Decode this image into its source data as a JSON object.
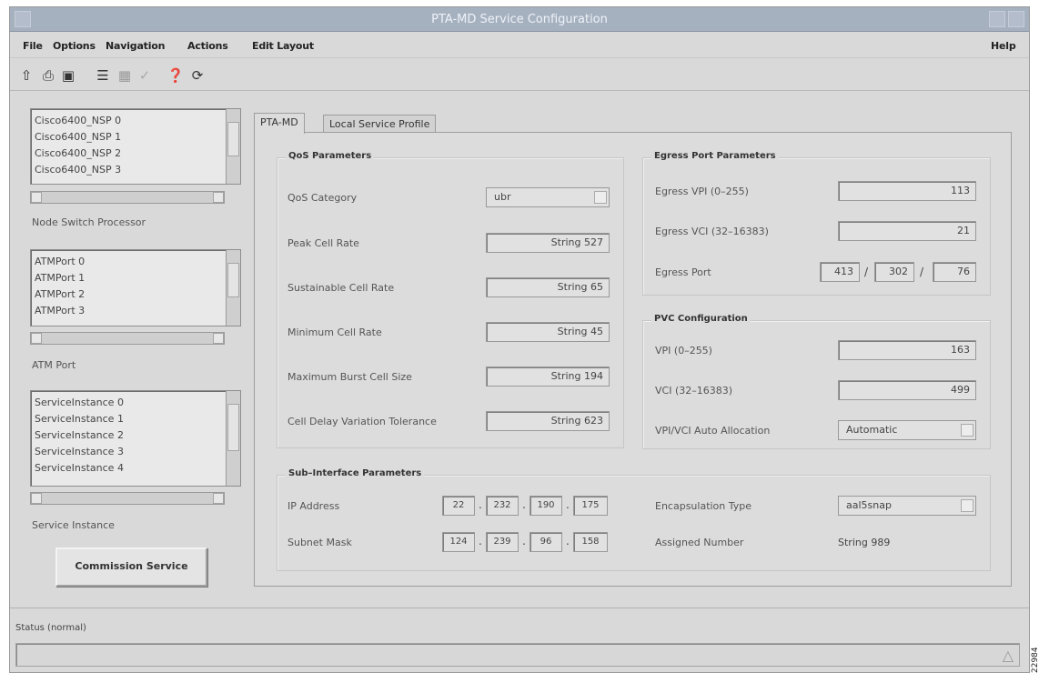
{
  "window": {
    "title": "PTA-MD Service Configuration"
  },
  "menus": [
    "File",
    "Options",
    "Navigation",
    "Actions",
    "Edit Layout"
  ],
  "help": "Help",
  "toolbar": {
    "icons": [
      "pointer-icon",
      "print-icon",
      "print-preview-icon",
      "list-icon",
      "form-icon",
      "checkmark-icon",
      "help-icon",
      "refresh-icon"
    ]
  },
  "lists": {
    "nsp": {
      "items": [
        "Cisco6400_NSP 0",
        "Cisco6400_NSP 1",
        "Cisco6400_NSP 2",
        "Cisco6400_NSP 3"
      ],
      "label": "Node Switch Processor"
    },
    "atm": {
      "items": [
        "ATMPort 0",
        "ATMPort 1",
        "ATMPort 2",
        "ATMPort 3"
      ],
      "label": "ATM Port"
    },
    "svc": {
      "items": [
        "ServiceInstance 0",
        "ServiceInstance 1",
        "ServiceInstance 2",
        "ServiceInstance 3",
        "ServiceInstance 4"
      ],
      "label": "Service Instance"
    }
  },
  "commission": "Commission Service",
  "tabs": [
    "PTA-MD",
    "Local Service Profile"
  ],
  "qos": {
    "title": "QoS Parameters",
    "category_label": "QoS Category",
    "category_value": "ubr",
    "rows": [
      {
        "label": "Peak Cell Rate",
        "value": "String 527"
      },
      {
        "label": "Sustainable Cell Rate",
        "value": "String 65"
      },
      {
        "label": "Minimum Cell Rate",
        "value": "String 45"
      },
      {
        "label": "Maximum Burst Cell Size",
        "value": "String 194"
      },
      {
        "label": "Cell Delay Variation Tolerance",
        "value": "String 623"
      }
    ]
  },
  "egress": {
    "title": "Egress Port Parameters",
    "vpi_label": "Egress VPI (0–255)",
    "vpi": "113",
    "vci_label": "Egress VCI (32–16383)",
    "vci": "21",
    "port_label": "Egress Port",
    "port": [
      "413",
      "302",
      "76"
    ]
  },
  "pvc": {
    "title": "PVC Configuration",
    "vpi_label": "VPI (0–255)",
    "vpi": "163",
    "vci_label": "VCI (32–16383)",
    "vci": "499",
    "auto_label": "VPI/VCI Auto Allocation",
    "auto": "Automatic"
  },
  "subif": {
    "title": "Sub–Interface Parameters",
    "ip_label": "IP Address",
    "ip": [
      "22",
      "232",
      "190",
      "175"
    ],
    "mask_label": "Subnet Mask",
    "mask": [
      "124",
      "239",
      "96",
      "158"
    ],
    "encap_label": "Encapsulation Type",
    "encap": "aal5snap",
    "assigned_label": "Assigned Number",
    "assigned": "String 989"
  },
  "status": {
    "label": "Status (normal)"
  },
  "side_id": "22984"
}
